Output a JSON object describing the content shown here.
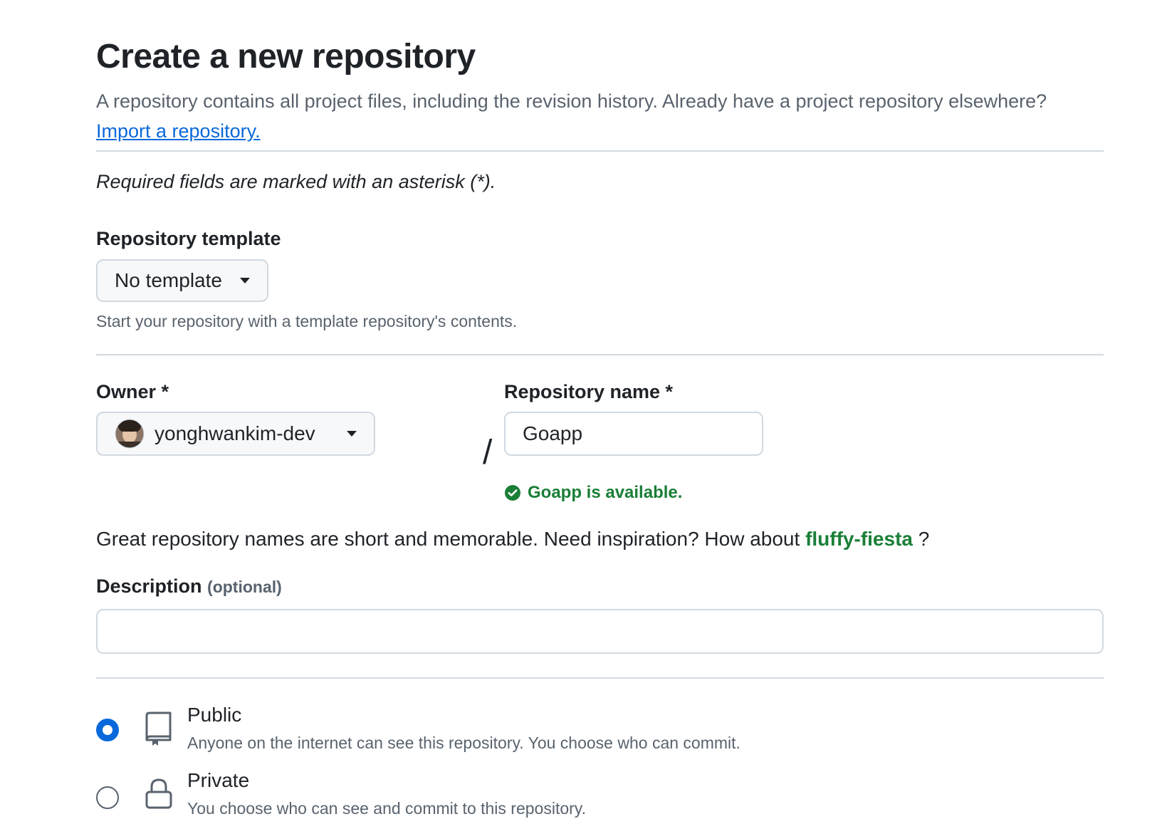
{
  "header": {
    "title": "Create a new repository",
    "description": "A repository contains all project files, including the revision history. Already have a project repository elsewhere?",
    "import_link": "Import a repository."
  },
  "required_note": "Required fields are marked with an asterisk (*).",
  "template": {
    "label": "Repository template",
    "selected": "No template",
    "hint": "Start your repository with a template repository's contents."
  },
  "owner": {
    "label": "Owner *",
    "selected": "yonghwankim-dev"
  },
  "separator": "/",
  "repo_name": {
    "label": "Repository name *",
    "value": "Goapp",
    "availability": "Goapp is available.",
    "status_color": "#1a7f37"
  },
  "suggestion": {
    "text": "Great repository names are short and memorable. Need inspiration? How about",
    "name": "fluffy-fiesta",
    "suffix": "?"
  },
  "description": {
    "label": "Description",
    "optional": "(optional)",
    "value": ""
  },
  "visibility": [
    {
      "title": "Public",
      "desc": "Anyone on the internet can see this repository. You choose who can commit.",
      "selected": true,
      "icon": "repo-icon"
    },
    {
      "title": "Private",
      "desc": "You choose who can see and commit to this repository.",
      "selected": false,
      "icon": "lock-icon"
    }
  ],
  "colors": {
    "accent": "#0969da",
    "success": "#1a7f37",
    "muted": "#59636e",
    "border": "#d1d9e0"
  }
}
